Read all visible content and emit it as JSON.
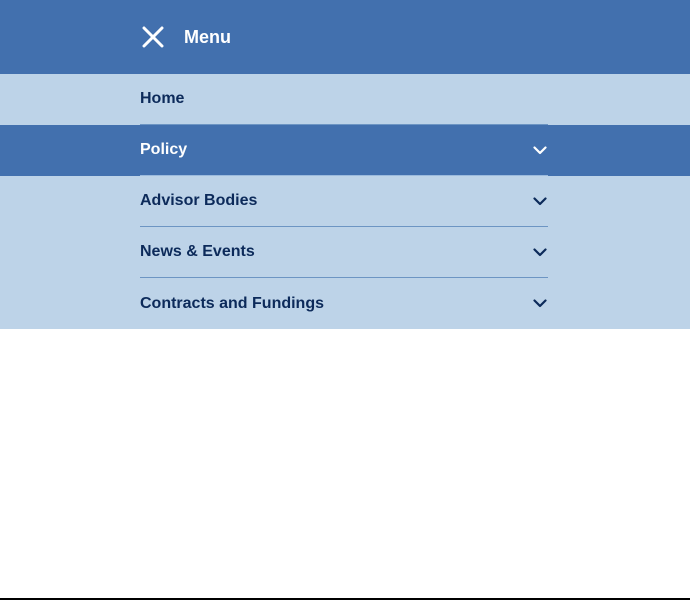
{
  "header": {
    "title": "Menu",
    "close_icon": "close-icon",
    "background": "#4270ae"
  },
  "nav": {
    "background": "#bdd3e8",
    "text_color": "#0c2a5a",
    "active_background": "#4270ae",
    "items": [
      {
        "label": "Home",
        "has_submenu": false,
        "active": false
      },
      {
        "label": "Policy",
        "has_submenu": true,
        "active": true,
        "icon": "chevron-down-icon"
      },
      {
        "label": "Advisor Bodies",
        "has_submenu": true,
        "active": false,
        "icon": "chevron-down-icon"
      },
      {
        "label": "News & Events",
        "has_submenu": true,
        "active": false,
        "icon": "chevron-down-icon"
      },
      {
        "label": "Contracts and Fundings",
        "has_submenu": true,
        "active": false,
        "icon": "chevron-down-icon"
      }
    ]
  }
}
